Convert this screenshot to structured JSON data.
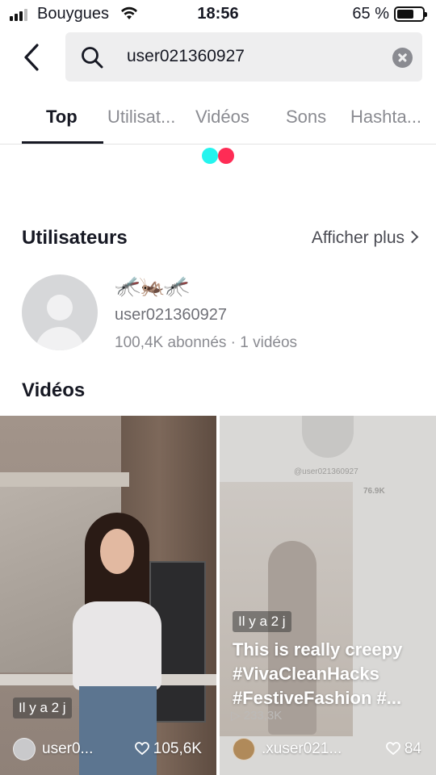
{
  "status_bar": {
    "carrier": "Bouygues",
    "time": "18:56",
    "battery_percent": "65 %",
    "battery_level": 0.65
  },
  "search": {
    "query": "user021360927"
  },
  "tabs": [
    {
      "label": "Top",
      "active": true
    },
    {
      "label": "Utilisat..."
    },
    {
      "label": "Vidéos"
    },
    {
      "label": "Sons"
    },
    {
      "label": "Hashta..."
    }
  ],
  "users_section": {
    "title": "Utilisateurs",
    "see_more": "Afficher plus",
    "user": {
      "display_name": "🦟🦗🦟",
      "username": "user021360927",
      "stats": "100,4K abonnés · 1 vidéos"
    }
  },
  "videos_section": {
    "title": "Vidéos",
    "items": [
      {
        "time_badge": "Il y a 2 j",
        "author": "user0...",
        "likes": "105,6K"
      },
      {
        "time_badge": "Il y a 2 j",
        "caption": "This is really creepy #VivaCleanHacks #FestiveFashion #...",
        "author": ".xuser021...",
        "likes": "84",
        "inner_screenshot": {
          "handle": "@user021360927",
          "count": "76.9K",
          "plays": "233,3K"
        }
      }
    ]
  },
  "colors": {
    "accent_cyan": "#25f4ee",
    "accent_red": "#fe2c55",
    "text_primary": "#161823",
    "text_secondary": "#8a8b91"
  }
}
